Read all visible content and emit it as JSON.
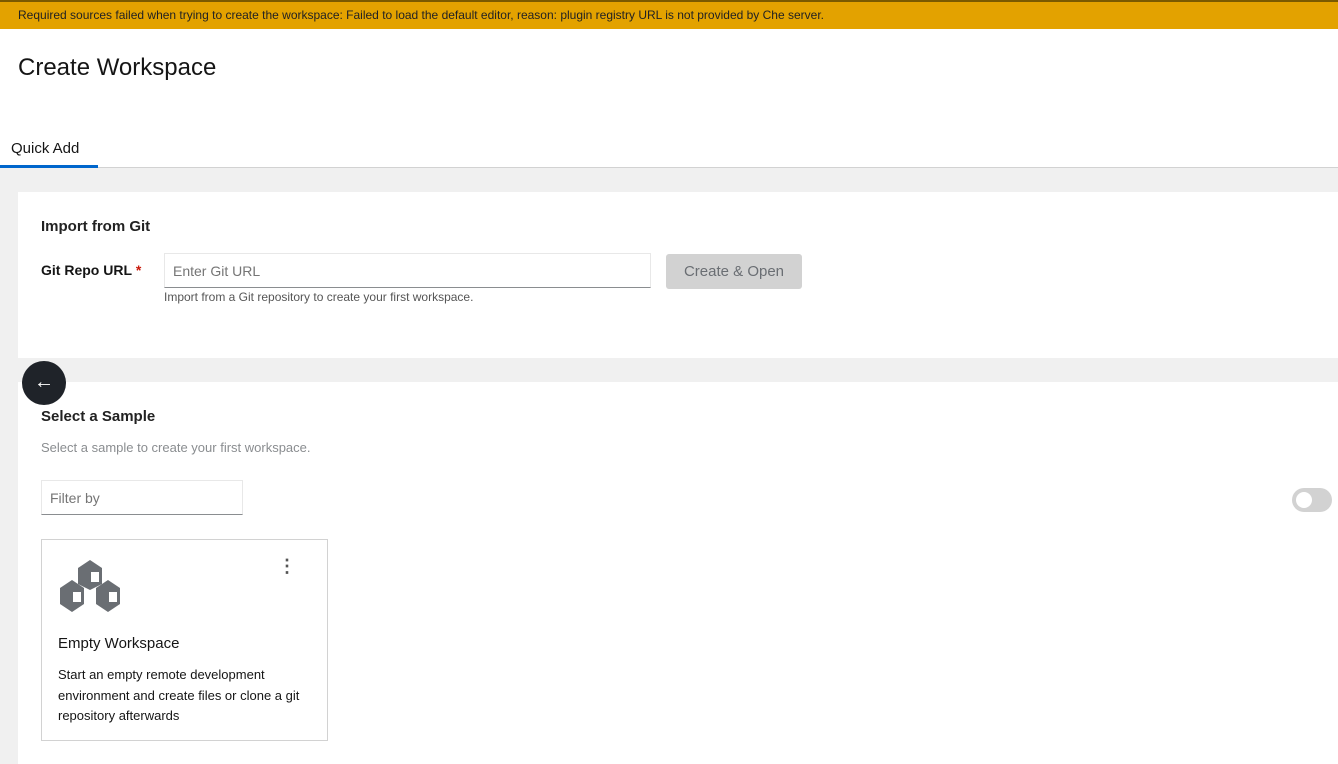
{
  "banner": {
    "message": "Required sources failed when trying to create the workspace: Failed to load the default editor, reason: plugin registry URL is not provided by Che server."
  },
  "page": {
    "title": "Create Workspace"
  },
  "tabs": [
    {
      "label": "Quick Add"
    }
  ],
  "import": {
    "heading": "Import from Git",
    "label": "Git Repo URL",
    "required": "*",
    "placeholder": "Enter Git URL",
    "helper": "Import from a Git repository to create your first workspace.",
    "button": "Create & Open"
  },
  "samples": {
    "heading": "Select a Sample",
    "subtitle": "Select a sample to create your first workspace.",
    "filter_placeholder": "Filter by",
    "cards": [
      {
        "name": "Empty Workspace",
        "description": "Start an empty remote development environment and create files or clone a git repository afterwards"
      }
    ]
  }
}
